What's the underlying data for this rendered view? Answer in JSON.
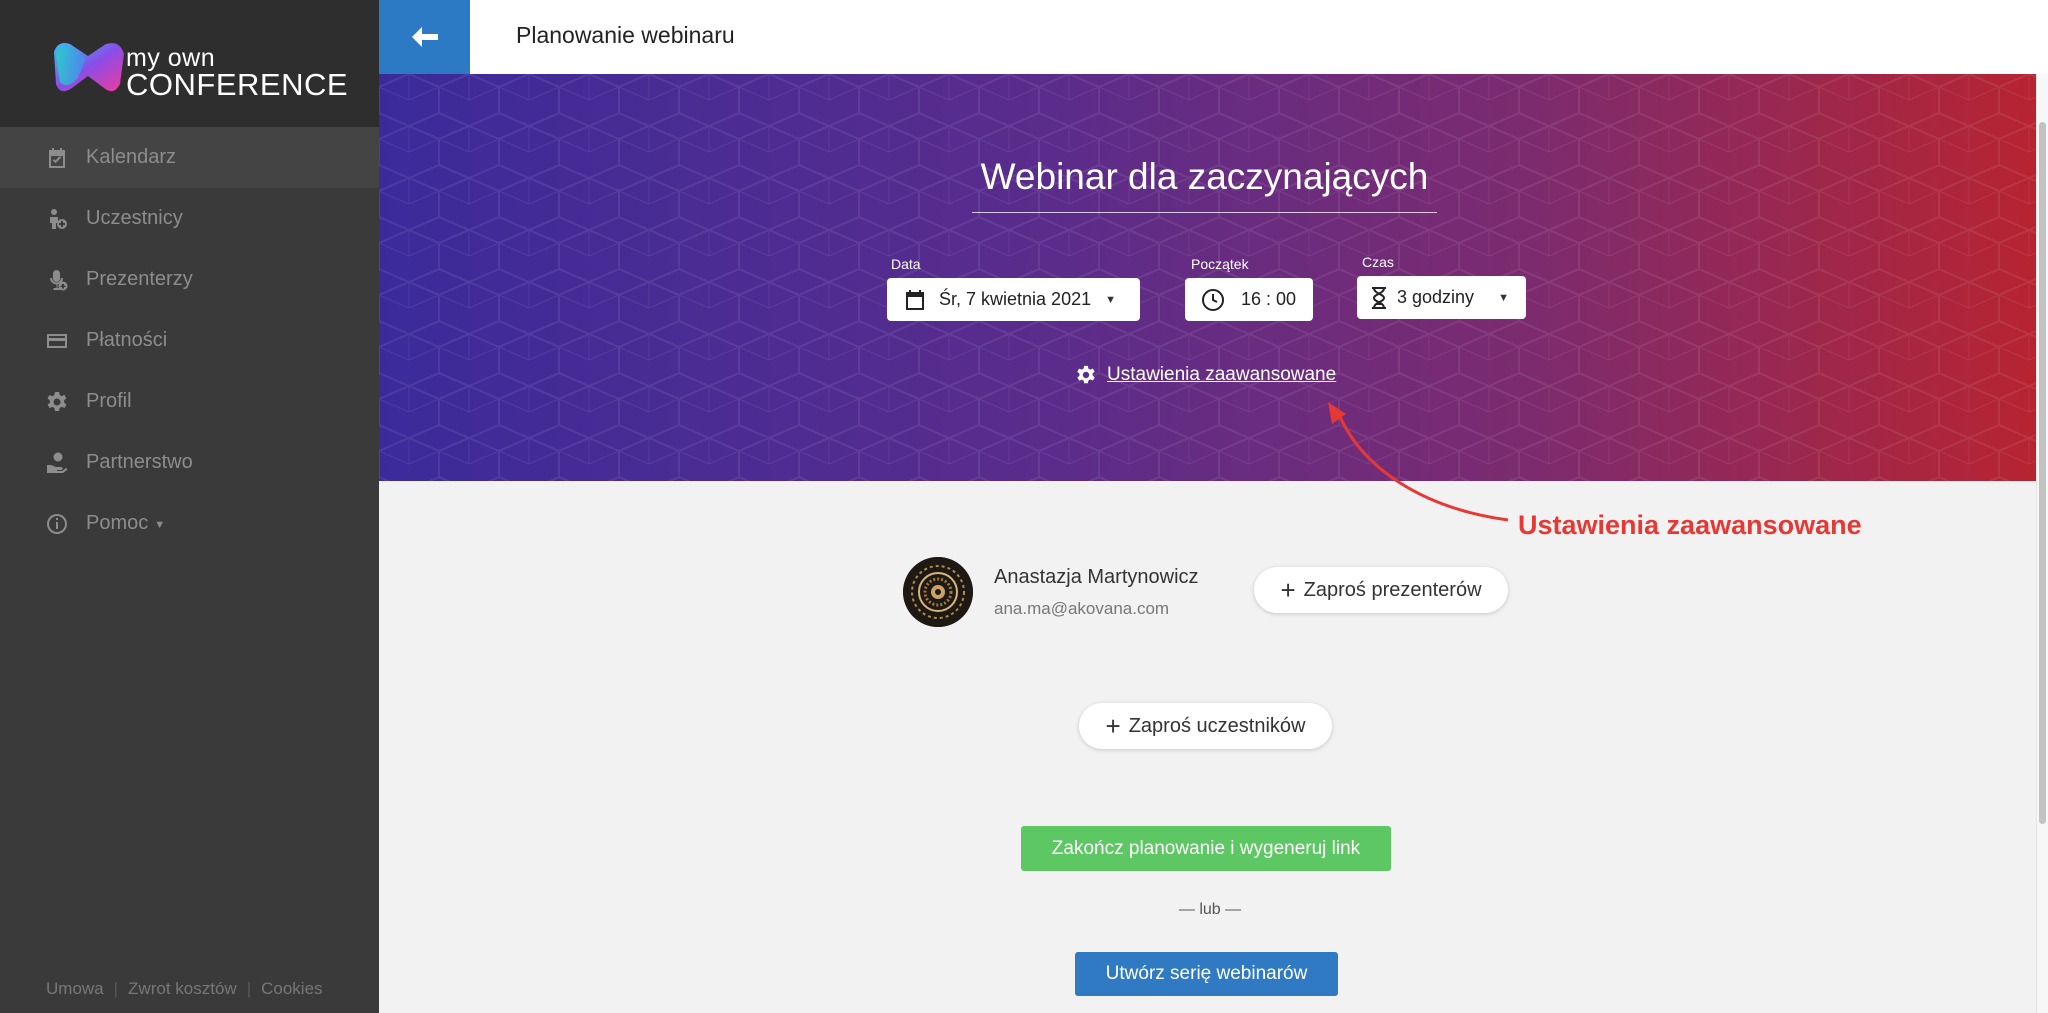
{
  "brand": {
    "line1": "my own",
    "line2": "CONFERENCE"
  },
  "sidebar": {
    "items": [
      {
        "label": "Kalendarz",
        "icon": "calendar-check-icon",
        "active": true
      },
      {
        "label": "Uczestnicy",
        "icon": "person-add-icon"
      },
      {
        "label": "Prezenterzy",
        "icon": "microphone-icon"
      },
      {
        "label": "Płatności",
        "icon": "credit-card-icon"
      },
      {
        "label": "Profil",
        "icon": "gear-icon"
      },
      {
        "label": "Partnerstwo",
        "icon": "hand-coin-icon"
      },
      {
        "label": "Pomoc",
        "icon": "info-circle-icon",
        "has_dropdown": true
      }
    ],
    "footer": {
      "link1": "Umowa",
      "link2": "Zwrot kosztów",
      "link3": "Cookies",
      "separator": "|"
    }
  },
  "header": {
    "title": "Planowanie webinaru",
    "back_icon": "arrow-left-icon"
  },
  "webinar": {
    "title": "Webinar dla zaczynających",
    "date": {
      "label": "Data",
      "value": "Śr, 7 kwietnia 2021"
    },
    "start": {
      "label": "Początek",
      "value": "16 : 00"
    },
    "duration": {
      "label": "Czas",
      "value": "3 godziny"
    },
    "advanced_settings": "Ustawienia zaawansowane"
  },
  "annotation": {
    "text": "Ustawienia zaawansowane",
    "color": "#e53935"
  },
  "presenter": {
    "name": "Anastazja Martynowicz",
    "email": "ana.ma@akovana.com"
  },
  "actions": {
    "invite_presenters": "Zaproś prezenterów",
    "invite_participants": "Zaproś uczestników",
    "finish": "Zakończ planowanie i wygeneruj link",
    "or": "— lub —",
    "create_series": "Utwórz serię webinarów"
  },
  "colors": {
    "accent_blue": "#2f7ac3",
    "success_green": "#5cc763",
    "sidebar_bg": "#3a3a3a"
  }
}
